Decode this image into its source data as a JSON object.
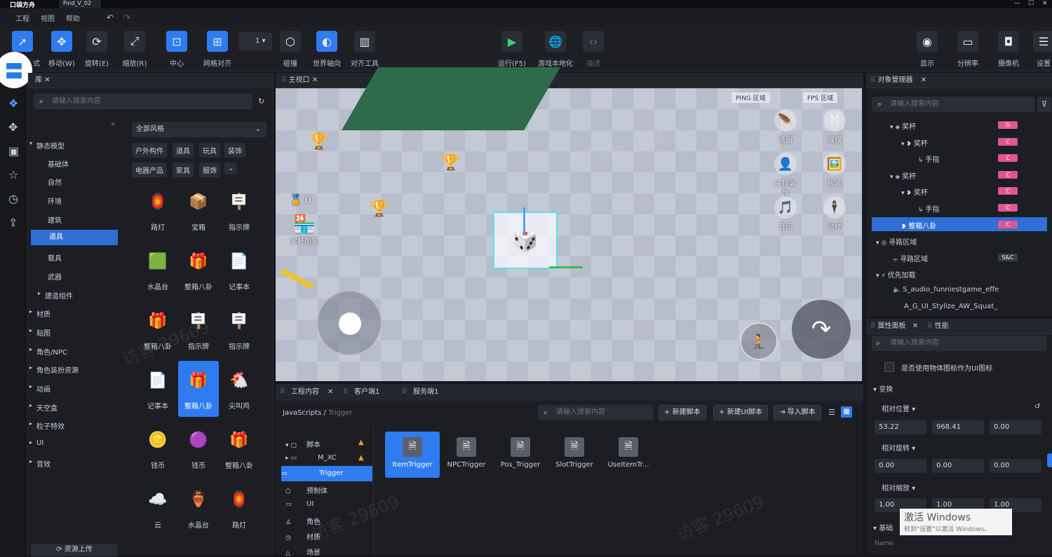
{
  "titlebar": {
    "app": "口袋方舟",
    "tab": "Find_V_02"
  },
  "menu": [
    "工程",
    "视图",
    "帮助"
  ],
  "toolbar": {
    "tools": [
      {
        "label": "式",
        "icon": "select-arrow-icon"
      },
      {
        "label": "移动(W)",
        "icon": "move-icon"
      },
      {
        "label": "旋转(E)",
        "icon": "rotate-icon"
      },
      {
        "label": "缩放(R)",
        "icon": "scale-icon"
      },
      {
        "label": "中心",
        "icon": "pivot-center-icon"
      },
      {
        "label": "网格对齐",
        "icon": "grid-snap-icon"
      },
      {
        "label": "碰撞",
        "icon": "collision-cube-icon"
      },
      {
        "label": "世界轴向",
        "icon": "world-axis-icon"
      },
      {
        "label": "对齐工具",
        "icon": "align-tool-icon"
      },
      {
        "label": "运行(F5)",
        "icon": "play-icon"
      },
      {
        "label": "游戏本地化",
        "icon": "globe-icon"
      },
      {
        "label": "描述",
        "icon": "code-brackets-icon"
      },
      {
        "label": "显示",
        "icon": "eye-icon"
      },
      {
        "label": "分辨率",
        "icon": "monitor-icon"
      },
      {
        "label": "摄像机",
        "icon": "camera-icon"
      },
      {
        "label": "设置",
        "icon": "sliders-icon"
      }
    ],
    "snap_value": "1"
  },
  "assets": {
    "tab": "库",
    "search_placeholder": "请输入搜索内容",
    "tree": [
      {
        "label": "静态模型",
        "expanded": true
      },
      {
        "label": "基础体"
      },
      {
        "label": "自然"
      },
      {
        "label": "环境"
      },
      {
        "label": "建筑"
      },
      {
        "label": "道具",
        "selected": true
      },
      {
        "label": "载具"
      },
      {
        "label": "武器"
      },
      {
        "label": "建造组件"
      },
      {
        "label": "材质"
      },
      {
        "label": "贴图"
      },
      {
        "label": "角色/NPC"
      },
      {
        "label": "角色装扮资源"
      },
      {
        "label": "动画"
      },
      {
        "label": "天空盒"
      },
      {
        "label": "粒子特效"
      },
      {
        "label": "UI"
      },
      {
        "label": "音效"
      }
    ],
    "style_filter": "全部风格",
    "tags": [
      "户外构件",
      "道具",
      "玩具",
      "装饰",
      "电器产品",
      "家具",
      "服饰"
    ],
    "items": [
      "路灯",
      "宝箱",
      "指示牌",
      "水晶台",
      "整箱八卦",
      "记事本",
      "整箱八卦",
      "指示牌",
      "指示牌",
      "记事本",
      "整箱八卦",
      "尖叫鸡",
      "钱币",
      "钱币",
      "整箱八卦",
      "云",
      "水晶台",
      "路灯"
    ],
    "upload_label": "资源上传"
  },
  "viewport": {
    "tab": "主视口",
    "ping_label": "PING 区域",
    "fps_label": "FPS 区域",
    "coins": "0",
    "collection_label": "奖杯图鉴",
    "hud": [
      "插画",
      "摇摆",
      "头顶装饰",
      "服装",
      "音乐",
      "动作"
    ]
  },
  "project": {
    "tabs": [
      "工程内容",
      "客户端1",
      "服务端1"
    ],
    "breadcrumb_root": "JavaScripts",
    "breadcrumb_sep": "/",
    "breadcrumb_current": "Trigger",
    "search_placeholder": "请输入搜索内容",
    "buttons": [
      "新建脚本",
      "新建UI脚本",
      "导入脚本"
    ],
    "tree": [
      "脚本",
      "M_XC",
      "Trigger",
      "预制体",
      "UI",
      "角色",
      "材质",
      "场景"
    ],
    "files": [
      "ItemTrigger",
      "NPCTrigger",
      "Pos_Trigger",
      "SlotTrigger",
      "UseItemTr..."
    ]
  },
  "objects": {
    "tab": "对象管理器",
    "search_placeholder": "请输入搜索内容",
    "tree": [
      {
        "label": "奖杯",
        "badge": "G"
      },
      {
        "label": "奖杯",
        "badge": "C"
      },
      {
        "label": "手指",
        "badge": "C"
      },
      {
        "label": "奖杯",
        "badge": "C"
      },
      {
        "label": "奖杯",
        "badge": "C"
      },
      {
        "label": "手指",
        "badge": "C"
      },
      {
        "label": "整箱八卦",
        "badge": "C",
        "selected": true
      },
      {
        "label": "寻路区域"
      },
      {
        "label": "寻路区域",
        "badge": "S&C"
      },
      {
        "label": "优先加载"
      },
      {
        "label": "S_audio_funniestgame_effe"
      },
      {
        "label": "A_G_UI_Stylize_AW_Squat_"
      }
    ]
  },
  "properties": {
    "tabs": [
      "属性面板",
      "性能"
    ],
    "search_placeholder": "请输入搜索内容",
    "checkbox_label": "是否使用物体图标作为UI图标",
    "section_transform": "变换",
    "rel_position": "相对位置",
    "position": [
      "53.22",
      "968.41",
      "0.00"
    ],
    "rel_rotation": "相对旋转",
    "rotation": [
      "0.00",
      "0.00",
      "0.00"
    ],
    "rel_scale": "相对缩放",
    "scale": [
      "1.00",
      "1.00",
      "1.00"
    ],
    "section_basic": "基础",
    "name_label": "Name"
  },
  "watermark": {
    "line1": "激活 Windows",
    "line2": "转到\"设置\"以激活 Windows。",
    "visitor": "访客 29609"
  }
}
